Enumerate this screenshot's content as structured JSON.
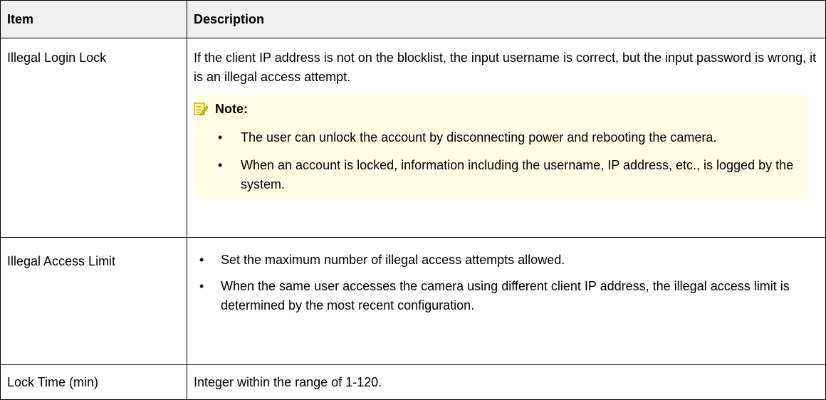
{
  "table": {
    "headers": {
      "item": "Item",
      "description": "Description"
    },
    "rows": [
      {
        "item": "Illegal Login Lock",
        "description": "If the client IP address is not on the blocklist, the input username is correct, but the input password is wrong, it is an illegal access attempt.",
        "note": {
          "title": "Note:",
          "icon": "note-pencil-icon",
          "bullets": [
            "The user can unlock the account by disconnecting power and rebooting the camera.",
            "When an account is locked, information including the username, IP address, etc., is logged by the system."
          ]
        }
      },
      {
        "item": "Illegal Access Limit",
        "bullets": [
          "Set the maximum number of illegal access attempts allowed.",
          "When the same user accesses the camera using different client IP address, the illegal access limit is determined by the most recent configuration."
        ]
      },
      {
        "item": "Lock Time (min)",
        "description": "Integer within the range of 1-120."
      }
    ],
    "bullet_char": "•"
  },
  "colors": {
    "header_bg": "#efefef",
    "note_bg": "#fffde3",
    "note_icon": "#d9c300",
    "border": "#000000"
  }
}
